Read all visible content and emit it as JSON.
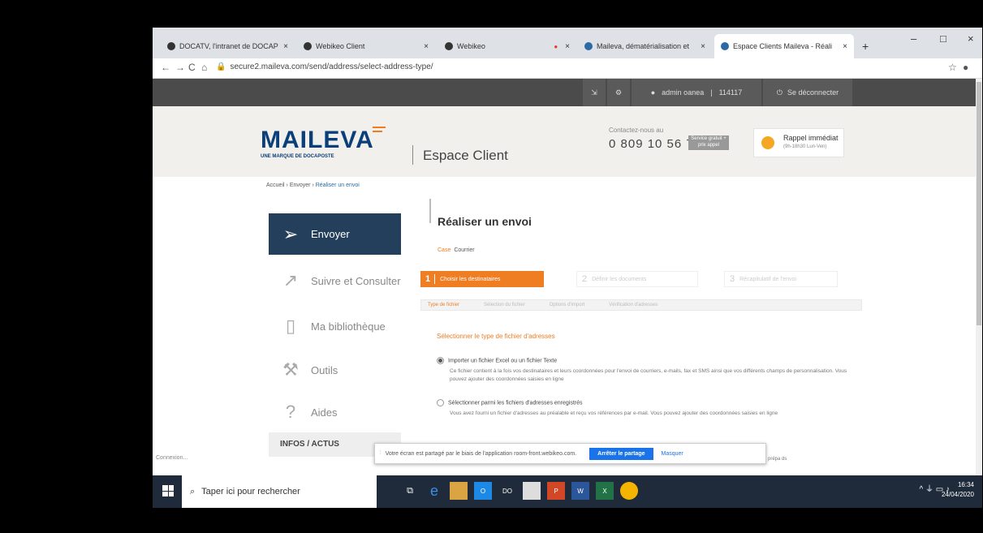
{
  "browser": {
    "tabs": [
      {
        "label": "DOCATV, l'intranet de DOCAP",
        "close": "×",
        "active": false
      },
      {
        "label": "Webikeo Client",
        "close": "×",
        "active": false
      },
      {
        "label": "Webikeo",
        "close": "×",
        "active": false
      },
      {
        "label": "Maileva, dématérialisation et",
        "close": "×",
        "active": false
      },
      {
        "label": "Espace Clients Maileva - Réali",
        "close": "×",
        "active": true
      }
    ],
    "new_tab": "+",
    "window_controls": {
      "minimize": "–",
      "maximize": "□",
      "close": "×"
    },
    "nav": {
      "back": "←",
      "forward": "→",
      "reload": "C",
      "home": "⌂"
    },
    "url": "secure2.maileva.com/send/address/select-address-type/"
  },
  "topbar": {
    "user": "admin oanea",
    "code": "114117",
    "logout": "Se déconnecter"
  },
  "header": {
    "logo": "MAILEVA",
    "logo_sub": "UNE MARQUE DE DOCAPOSTE",
    "space": "Espace Client",
    "contact_label": "Contactez-nous au",
    "phone": "0 809 10 56 78",
    "service": "Service gratuit + prix appel",
    "rappel_title": "Rappel immédiat",
    "rappel_hours": "(9h-18h30 Lun-Ven)"
  },
  "breadcrumb": {
    "home": "Accueil",
    "send": "Envoyer",
    "current": "Réaliser un envoi"
  },
  "sidebar": {
    "items": [
      {
        "label": "Envoyer",
        "icon": "send-icon"
      },
      {
        "label": "Suivre et Consulter",
        "icon": "chart-icon"
      },
      {
        "label": "Ma bibliothèque",
        "icon": "book-icon"
      },
      {
        "label": "Outils",
        "icon": "wrench-icon"
      },
      {
        "label": "Aides",
        "icon": "help-icon"
      }
    ],
    "infos": "INFOS / ACTUS"
  },
  "main": {
    "title": "Réaliser un envoi",
    "case_label": "Case",
    "case_value": "Courrier",
    "steps": [
      {
        "num": "1",
        "label": "Choisir les destinataires"
      },
      {
        "num": "2",
        "label": "Définir les documents"
      },
      {
        "num": "3",
        "label": "Récapitulatif de l'envoi"
      }
    ],
    "subtabs": [
      "Type de fichier",
      "Sélection du fichier",
      "Options d'import",
      "Vérification d'adresses"
    ],
    "select_title": "Sélectionner le type de fichier d'adresses",
    "options": [
      {
        "label": "Importer un fichier Excel ou un fichier Texte",
        "desc": "Ce fichier contient à la fois vos destinataires et leurs coordonnées pour l'envoi de courriers, e-mails, fax et SMS ainsi que vos différents champs de personnalisation. Vous pouvez ajouter des coordonnées saisies en ligne"
      },
      {
        "label": "Sélectionner parmi les fichiers d'adresses enregistrés",
        "desc": "Vous avez fourni un fichier d'adresses au préalable et reçu vos références par e-mail. Vous pouvez ajouter des coordonnées saisies en ligne"
      }
    ]
  },
  "share": {
    "text": "Votre écran est partagé par le biais de l'application room-front.webikeo.com.",
    "stop": "Arrêter le partage",
    "hide": "Masquer",
    "tail": "prépa ds"
  },
  "status": "Connexion...",
  "taskbar": {
    "search": "Taper ici pour rechercher",
    "time": "16:34",
    "date": "24/04/2020"
  }
}
